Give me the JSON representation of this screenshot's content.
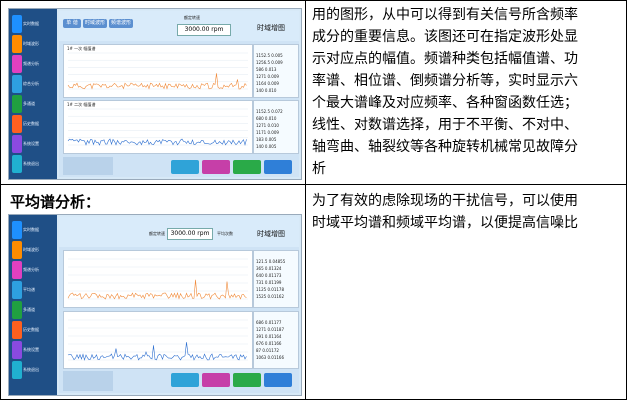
{
  "content": {
    "row1_text": "用的图形，从中可以得到有关信号所含频率\n成分的重要信息。该图还可在指定波形处显\n示对应点的幅值。频谱种类包括幅值谱、功\n率谱、相位谱、倒频谱分析等，实时显示六\n个最大谱峰及对应频率、各种窗函数任选；\n线性、对数谱选择，用于不平衡、不对中、\n轴弯曲、轴裂纹等各种旋转机械常见故障分\n析",
    "row2_heading": "平均谱分析：",
    "row2_text": "为了有效的虑除现场的干扰信号，可以使用\n时域平均谱和频域平均谱，以便提高信噪比"
  },
  "screenshot1": {
    "speed_label": "额定转速",
    "speed_value": "3000.00 rpm",
    "mode_title": "时域增图",
    "tabs": [
      "单 谐",
      "时域波形",
      "频谱波形"
    ],
    "plot1_label": "1# 一次 幅值谱",
    "plot2_label": "1# 二次 幅值谱",
    "peaks1": [
      {
        "f": "1152.5",
        "a": "0.005"
      },
      {
        "f": "1256.5",
        "a": "0.009"
      },
      {
        "f": "586",
        "a": "0.013"
      },
      {
        "f": "1271",
        "a": "0.009"
      },
      {
        "f": "1164",
        "a": "0.009"
      },
      {
        "f": "140",
        "a": "0.010"
      }
    ],
    "peaks2": [
      {
        "f": "1152.5",
        "a": "0.072"
      },
      {
        "f": "680",
        "a": "0.010"
      },
      {
        "f": "1271",
        "a": "0.010"
      },
      {
        "f": "1171",
        "a": "0.009"
      },
      {
        "f": "183",
        "a": "0.005"
      },
      {
        "f": "140",
        "a": "0.005"
      }
    ],
    "buttons": [
      "",
      "",
      "",
      ""
    ],
    "sidebar_labels": [
      "实时数据",
      "时域波形",
      "频谱分析",
      "综合分析",
      "多通道",
      "历史数据",
      "系统设置",
      "系统退出"
    ]
  },
  "screenshot2": {
    "speed_label": "额定转速",
    "speed_value": "3000.00 rpm",
    "avg_label": "平均次数",
    "mode_title": "时域增图",
    "peaks1": [
      {
        "f": "121.5",
        "a": "0.04855"
      },
      {
        "f": "365",
        "a": "0.01324"
      },
      {
        "f": "640",
        "a": "0.01173"
      },
      {
        "f": "731",
        "a": "0.01199"
      },
      {
        "f": "1125",
        "a": "0.01178"
      },
      {
        "f": "1525",
        "a": "0.01162"
      }
    ],
    "peaks2": [
      {
        "f": "686",
        "a": "0.01177"
      },
      {
        "f": "1271",
        "a": "0.01187"
      },
      {
        "f": "391",
        "a": "0.01164"
      },
      {
        "f": "676",
        "a": "0.01166"
      },
      {
        "f": "87",
        "a": "0.01172"
      },
      {
        "f": "1063",
        "a": "0.01166"
      }
    ],
    "sidebar_labels": [
      "实时数据",
      "时域波形",
      "频谱分析",
      "平均谱",
      "多通道",
      "历史数据",
      "系统设置",
      "系统退出"
    ]
  },
  "colors": {
    "sidebar": "#1f4f86",
    "icons": [
      "#1e90ff",
      "#ff8c00",
      "#e040c0",
      "#2ea0e0",
      "#20a040",
      "#ff6020",
      "#8a4ae0",
      "#20b0d0"
    ],
    "buttons": [
      "#2fa3d8",
      "#c63fa8",
      "#2aaa48",
      "#2f7fd8"
    ]
  }
}
